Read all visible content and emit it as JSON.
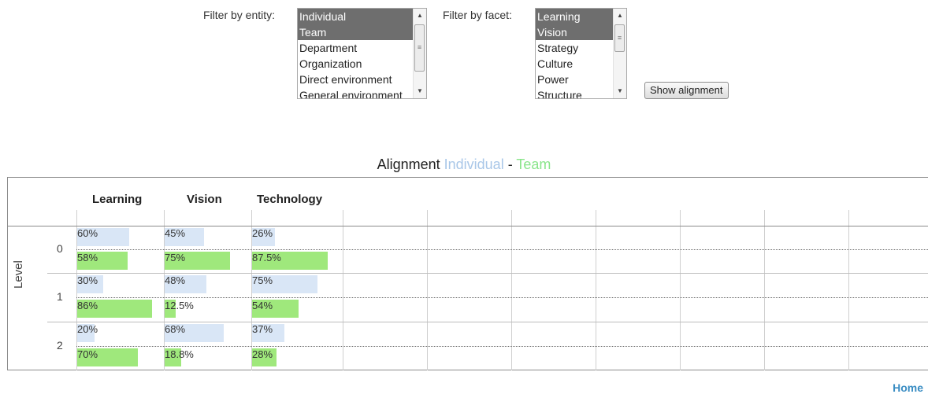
{
  "filters": {
    "entity_label": "Filter by entity:",
    "entity_options": [
      {
        "label": "Individual",
        "selected": true
      },
      {
        "label": "Team",
        "selected": true
      },
      {
        "label": "Department",
        "selected": false
      },
      {
        "label": "Organization",
        "selected": false
      },
      {
        "label": "Direct environment",
        "selected": false
      },
      {
        "label": "General environment",
        "selected": false
      }
    ],
    "facet_label": "Filter by facet:",
    "facet_options": [
      {
        "label": "Learning",
        "selected": true
      },
      {
        "label": "Vision",
        "selected": true
      },
      {
        "label": "Strategy",
        "selected": false
      },
      {
        "label": "Culture",
        "selected": false
      },
      {
        "label": "Power",
        "selected": false
      },
      {
        "label": "Structure",
        "selected": false
      }
    ],
    "show_button": "Show alignment"
  },
  "alignment": {
    "title_prefix": "Alignment",
    "series1": "Individual",
    "separator": "-",
    "series2": "Team",
    "series1_color": "#a9c7e8",
    "series2_color": "#89e58a",
    "columns": [
      "Learning",
      "Vision",
      "Technology"
    ],
    "axis_label": "Level",
    "levels": [
      "0",
      "1",
      "2"
    ],
    "rows": [
      {
        "level": "0",
        "cells": [
          {
            "individual": 60,
            "team": 58,
            "individual_label": "60%",
            "team_label": "58%"
          },
          {
            "individual": 45,
            "team": 75,
            "individual_label": "45%",
            "team_label": "75%"
          },
          {
            "individual": 26,
            "team": 87.5,
            "individual_label": "26%",
            "team_label": "87.5%"
          }
        ]
      },
      {
        "level": "1",
        "cells": [
          {
            "individual": 30,
            "team": 86,
            "individual_label": "30%",
            "team_label": "86%"
          },
          {
            "individual": 48,
            "team": 12.5,
            "individual_label": "48%",
            "team_label": "12.5%"
          },
          {
            "individual": 75,
            "team": 54,
            "individual_label": "75%",
            "team_label": "54%"
          }
        ]
      },
      {
        "level": "2",
        "cells": [
          {
            "individual": 20,
            "team": 70,
            "individual_label": "20%",
            "team_label": "70%"
          },
          {
            "individual": 68,
            "team": 18.8,
            "individual_label": "68%",
            "team_label": "18.8%"
          },
          {
            "individual": 37,
            "team": 28,
            "individual_label": "37%",
            "team_label": "28%"
          }
        ]
      }
    ]
  },
  "footer": {
    "home_link": "Home"
  }
}
